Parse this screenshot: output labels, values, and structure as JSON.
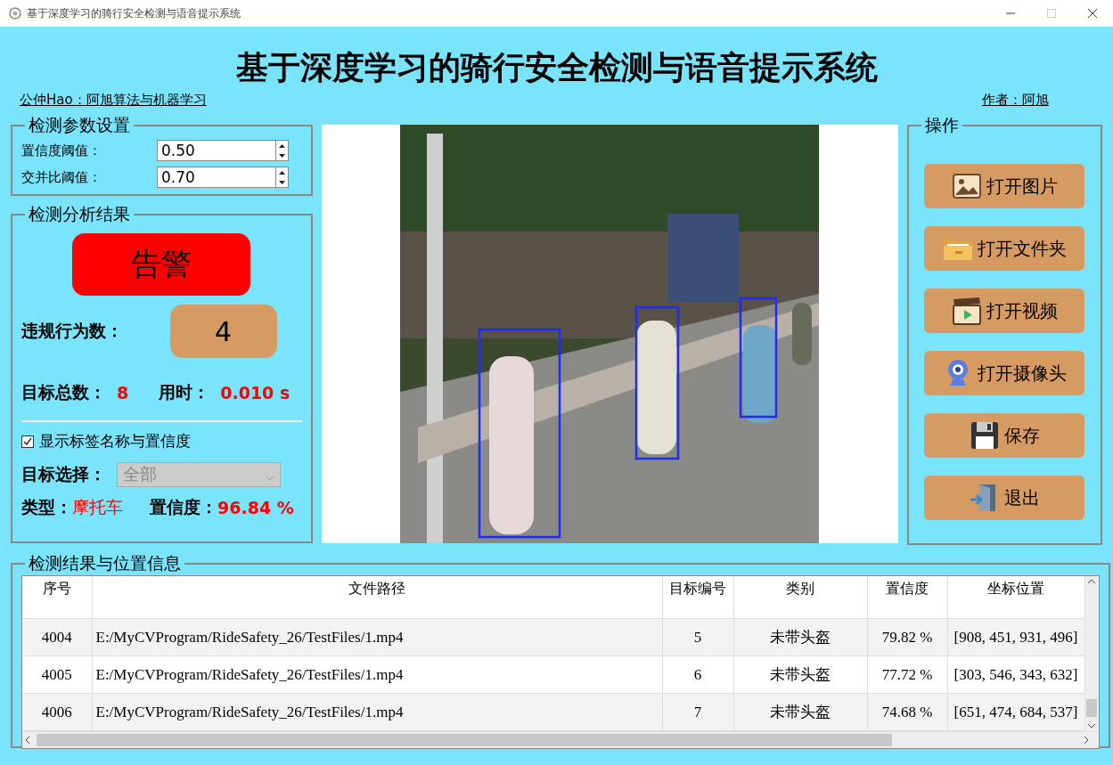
{
  "window": {
    "title": "基于深度学习的骑行安全检测与语音提示系统"
  },
  "header": {
    "title": "基于深度学习的骑行安全检测与语音提示系统",
    "left_link": "公仲Hao：阿旭算法与机器学习",
    "right_link": "作者：阿旭"
  },
  "params": {
    "title": "检测参数设置",
    "fields": [
      {
        "label": "置信度阈值：",
        "value": "0.50"
      },
      {
        "label": "交并比阈值：",
        "value": "0.70"
      }
    ]
  },
  "results": {
    "title": "检测分析结果",
    "alert": "告警",
    "violations_label": "违规行为数：",
    "violations": "4",
    "total_label": "目标总数：",
    "total": "8",
    "time_label": "用时：",
    "time": "0.010 s",
    "show_labels": {
      "label": "显示标签名称与置信度",
      "checked": true
    },
    "target_label": "目标选择：",
    "target_select": {
      "value": "全部",
      "disabled": true
    },
    "type_label": "类型：",
    "type": "摩托车",
    "conf_label": "置信度：",
    "conf": "96.84 %"
  },
  "actions": {
    "title": "操作",
    "buttons": [
      {
        "label": "打开图片"
      },
      {
        "label": "打开文件夹"
      },
      {
        "label": "打开视频"
      },
      {
        "label": "打开摄像头"
      },
      {
        "label": "保存"
      },
      {
        "label": "退出"
      }
    ]
  },
  "table": {
    "title": "检测结果与位置信息",
    "columns": [
      "序号",
      "文件路径",
      "目标编号",
      "类别",
      "置信度",
      "坐标位置"
    ],
    "rows": [
      [
        "4004",
        "E:/MyCVProgram/RideSafety_26/TestFiles/1.mp4",
        "5",
        "未带头盔",
        "79.82 %",
        "[908, 451, 931, 496]"
      ],
      [
        "4005",
        "E:/MyCVProgram/RideSafety_26/TestFiles/1.mp4",
        "6",
        "未带头盔",
        "77.72 %",
        "[303, 546, 343, 632]"
      ],
      [
        "4006",
        "E:/MyCVProgram/RideSafety_26/TestFiles/1.mp4",
        "7",
        "未带头盔",
        "74.68 %",
        "[651, 474, 684, 537]"
      ]
    ]
  }
}
